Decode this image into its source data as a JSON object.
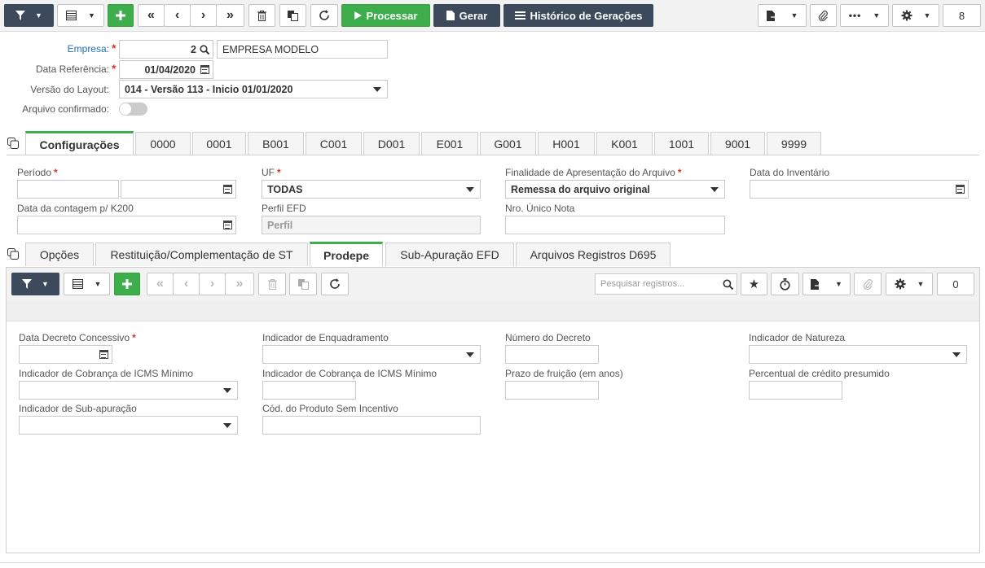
{
  "toolbar": {
    "processar_label": "Processar",
    "gerar_label": "Gerar",
    "historico_label": "Histórico de Gerações",
    "count": "8"
  },
  "header": {
    "empresa_label": "Empresa:",
    "empresa_code": "2",
    "empresa_name": "EMPRESA MODELO",
    "data_ref_label": "Data Referência:",
    "data_ref_value": "01/04/2020",
    "versao_label": "Versão do Layout:",
    "versao_value": "014 - Versão 113 - Inicio 01/01/2020",
    "confirmado_label": "Arquivo confirmado:"
  },
  "tabs": [
    "Configurações",
    "0000",
    "0001",
    "B001",
    "C001",
    "D001",
    "E001",
    "G001",
    "H001",
    "K001",
    "1001",
    "9001",
    "9999"
  ],
  "config": {
    "periodo_label": "Período",
    "uf_label": "UF",
    "uf_value": "TODAS",
    "finalidade_label": "Finalidade de Apresentação do Arquivo",
    "finalidade_value": "Remessa do arquivo original",
    "data_inventario_label": "Data do Inventário",
    "data_contagem_label": "Data da contagem p/ K200",
    "perfil_label": "Perfil EFD",
    "perfil_placeholder": "Perfil",
    "nro_nota_label": "Nro. Único Nota"
  },
  "subtabs": [
    "Opções",
    "Restituição/Complementação de ST",
    "Prodepe",
    "Sub-Apuração EFD",
    "Arquivos Registros D695"
  ],
  "subtoolbar": {
    "search_placeholder": "Pesquisar registros...",
    "count": "0"
  },
  "prodepe": {
    "data_decreto_label": "Data Decreto Concessivo",
    "ind_enquadramento_label": "Indicador de Enquadramento",
    "numero_decreto_label": "Número do Decreto",
    "ind_natureza_label": "Indicador de Natureza",
    "ind_cobranca_1_label": "Indicador de Cobrança de ICMS Mínimo",
    "ind_cobranca_2_label": "Indicador de Cobrança de ICMS Mínimo",
    "prazo_label": "Prazo de fruição (em anos)",
    "percentual_label": "Percentual de crédito presumido",
    "ind_subapuracao_label": "Indicador de Sub-apuração",
    "cod_produto_label": "Cód. do Produto Sem Incentivo"
  },
  "colors": {
    "accent": "#3dae4b",
    "dark": "#3c4a5c",
    "required": "#d9362b",
    "link": "#1e6fc2"
  }
}
